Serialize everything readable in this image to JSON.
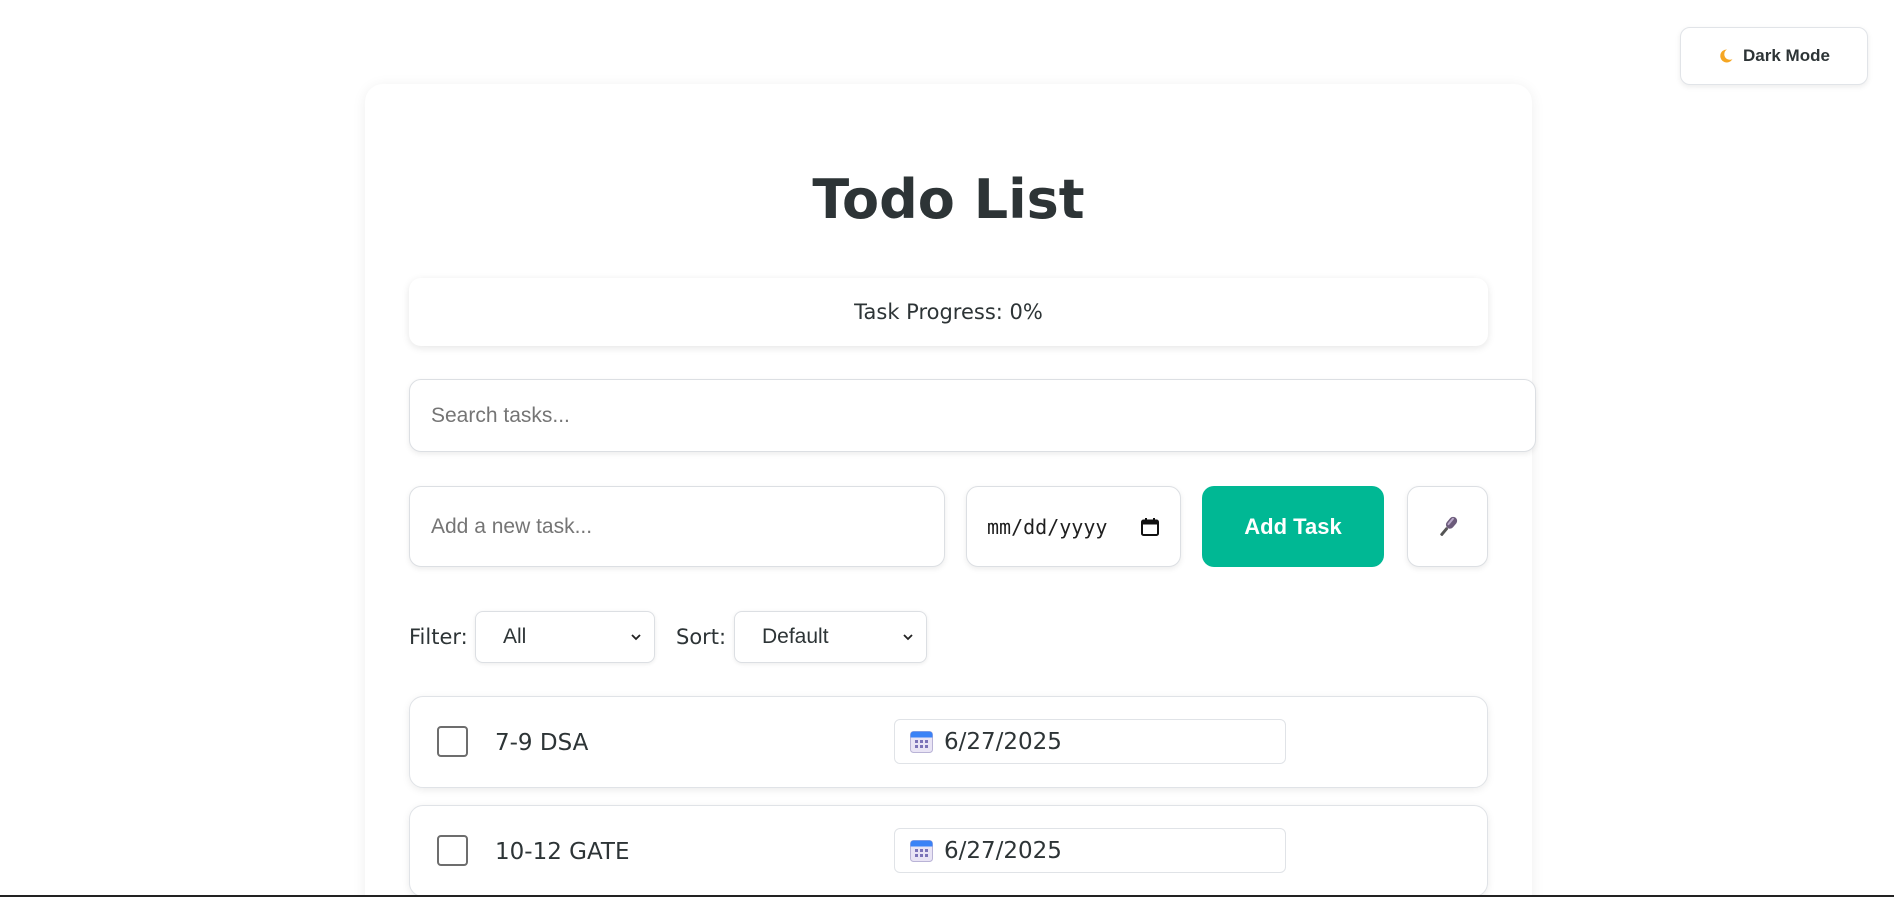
{
  "header": {
    "dark_mode_label": "Dark Mode",
    "dark_mode_icon": "moon-icon"
  },
  "main": {
    "title": "Todo List",
    "progress_text": "Task Progress: 0%",
    "progress_value": 0,
    "search": {
      "placeholder": "Search tasks...",
      "value": ""
    },
    "new_task": {
      "placeholder": "Add a new task...",
      "value": ""
    },
    "date_input": {
      "placeholder": "mm/dd/yyyy",
      "icon": "calendar-icon"
    },
    "add_button_label": "Add Task",
    "mic_icon": "microphone-icon",
    "filter": {
      "label": "Filter:",
      "selected": "All"
    },
    "sort": {
      "label": "Sort:",
      "selected": "Default"
    },
    "tasks": [
      {
        "text": "7-9 DSA",
        "due": "6/27/2025",
        "done": false
      },
      {
        "text": "10-12 GATE",
        "due": "6/27/2025",
        "done": false
      }
    ]
  },
  "colors": {
    "accent": "#00b894",
    "text": "#2d3436",
    "background": "#ffffff"
  }
}
